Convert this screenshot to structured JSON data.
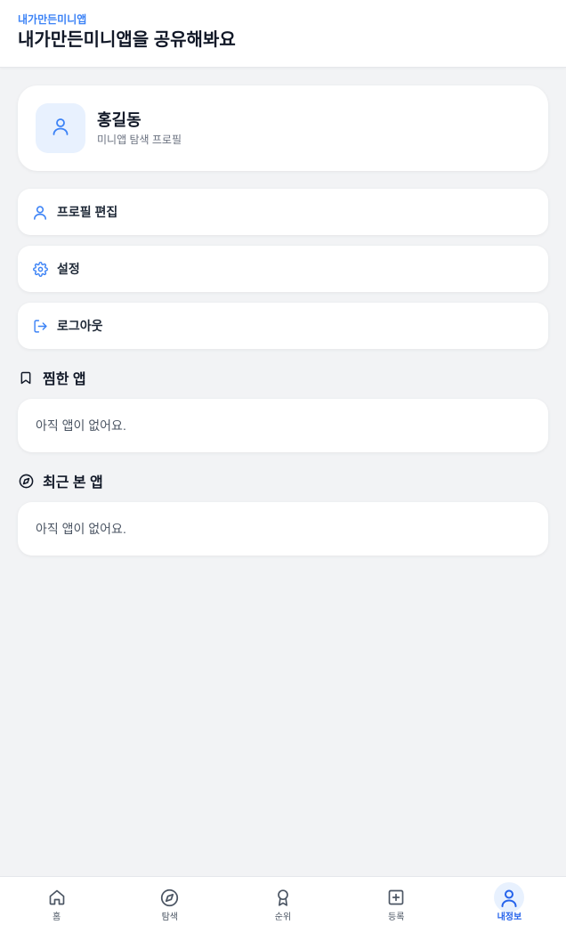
{
  "header": {
    "app_name": "내가만든미니앱",
    "tagline": "내가만든미니앱을 공유해봐요"
  },
  "profile": {
    "name": "홍길동",
    "subtitle": "미니앱 탐색 프로필",
    "avatar_icon": "user-icon"
  },
  "menu": [
    {
      "label": "프로필 편집",
      "icon": "user-icon"
    },
    {
      "label": "설정",
      "icon": "gear-icon"
    },
    {
      "label": "로그아웃",
      "icon": "logout-icon"
    }
  ],
  "sections": {
    "saved": {
      "title": "찜한 앱",
      "icon": "bookmark-icon",
      "empty_text": "아직 앱이 없어요."
    },
    "recent": {
      "title": "최근 본 앱",
      "icon": "compass-icon",
      "empty_text": "아직 앱이 없어요."
    }
  },
  "bottom_nav": [
    {
      "label": "홈",
      "icon": "home-icon",
      "active": false
    },
    {
      "label": "탐색",
      "icon": "compass-icon",
      "active": false
    },
    {
      "label": "순위",
      "icon": "award-icon",
      "active": false
    },
    {
      "label": "등록",
      "icon": "plus-square-icon",
      "active": false
    },
    {
      "label": "내정보",
      "icon": "user-icon",
      "active": true
    }
  ],
  "colors": {
    "accent": "#3b82f6",
    "accent_active": "#2563eb",
    "background": "#f2f3f5",
    "card": "#ffffff"
  }
}
